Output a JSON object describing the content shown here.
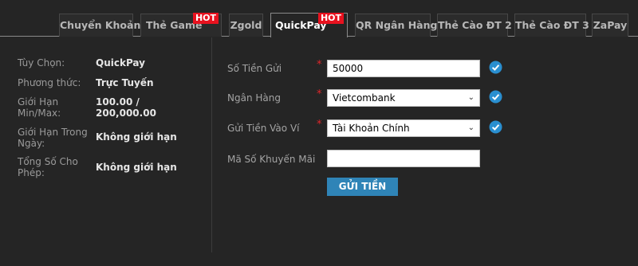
{
  "tabs": [
    {
      "label": "Chuyển Khoản",
      "hot": ""
    },
    {
      "label": "Thẻ Game",
      "hot": "HOT"
    },
    {
      "label": "Zgold",
      "hot": ""
    },
    {
      "label": "QuickPay",
      "hot": "HOT",
      "active": true
    },
    {
      "label": "QR Ngân Hàng",
      "hot": ""
    },
    {
      "label": "Thẻ Cào ĐT 2",
      "hot": ""
    },
    {
      "label": "Thẻ Cào ĐT 3",
      "hot": ""
    },
    {
      "label": "ZaPay",
      "hot": ""
    }
  ],
  "info": {
    "option_label": "Tùy Chọn:",
    "option_value": "QuickPay",
    "method_label": "Phương thức:",
    "method_value": "Trực Tuyến",
    "limit_label": "Giới Hạn Min/Max:",
    "limit_value": "100.00 / 200,000.00",
    "daily_label": "Giới Hạn Trong Ngày:",
    "daily_value": "Không giới hạn",
    "total_label": "Tổng Số Cho Phép:",
    "total_value": "Không giới hạn"
  },
  "form": {
    "amount_label": "Số Tiền Gửi",
    "amount_value": "50000",
    "bank_label": "Ngân Hàng",
    "bank_value": "Vietcombank",
    "wallet_label": "Gửi Tiền Vào Ví",
    "wallet_value": "Tài Khoản Chính",
    "promo_label": "Mã Số Khuyến Mãi",
    "promo_value": "",
    "required_mark": "*",
    "submit_label": "GỬI TIỀN"
  },
  "colors": {
    "background": "#252525",
    "hot_badge": "#e8121f",
    "submit_button": "#2f84b7",
    "check_icon": "#2a8fd0",
    "required": "#e0262a"
  }
}
